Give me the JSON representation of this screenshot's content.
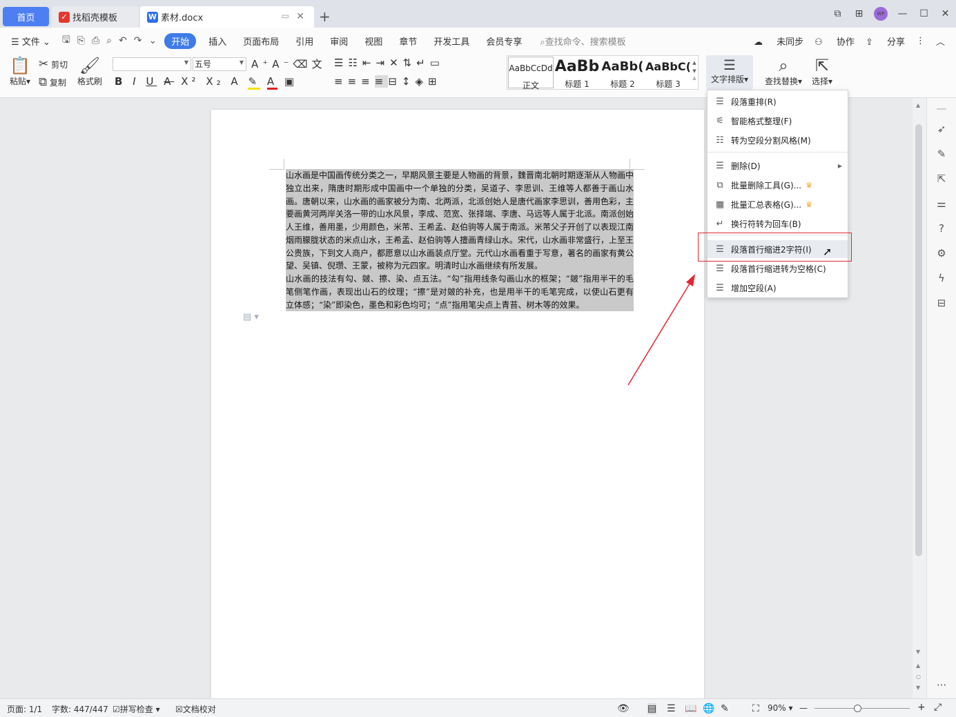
{
  "tabs": {
    "home": "首页",
    "template": "找稻壳模板",
    "document": "素材.docx"
  },
  "avatar_text": "WP",
  "menu": {
    "file": "文件",
    "items": [
      "开始",
      "插入",
      "页面布局",
      "引用",
      "审阅",
      "视图",
      "章节",
      "开发工具",
      "会员专享"
    ],
    "active": "开始",
    "search_placeholder": "查找命令、搜索模板",
    "right": [
      "未同步",
      "协作",
      "分享"
    ]
  },
  "ribbon": {
    "paste": "粘贴",
    "cut": "剪切",
    "copy": "复制",
    "format_painter": "格式刷",
    "font_name": "",
    "font_size": "五号",
    "styles": [
      {
        "preview": "AaBbCcDd",
        "label": "正文"
      },
      {
        "preview": "AaBb",
        "label": "标题 1"
      },
      {
        "preview": "AaBb(",
        "label": "标题 2"
      },
      {
        "preview": "AaBbC(",
        "label": "标题 3"
      }
    ],
    "text_layout": "文字排版",
    "find_replace": "查找替换",
    "select": "选择"
  },
  "dropdown": {
    "items": [
      {
        "label": "段落重排(R)",
        "icon": "paragraph-rearrange-icon",
        "group": 1
      },
      {
        "label": "智能格式整理(F)",
        "icon": "smart-format-icon",
        "group": 1
      },
      {
        "label": "转为空段分割风格(M)",
        "icon": "empty-paragraph-icon",
        "group": 1
      },
      {
        "label": "删除(D)",
        "icon": "delete-icon",
        "group": 2,
        "submenu": true
      },
      {
        "label": "批量删除工具(G)...",
        "icon": "batch-delete-icon",
        "group": 2,
        "premium": true
      },
      {
        "label": "批量汇总表格(G)...",
        "icon": "batch-table-icon",
        "group": 2,
        "premium": true
      },
      {
        "label": "换行符转为回车(B)",
        "icon": "linebreak-icon",
        "group": 2
      },
      {
        "label": "段落首行缩进2字符(I)",
        "icon": "indent-icon",
        "group": 3,
        "highlighted": true
      },
      {
        "label": "段落首行缩进转为空格(C)",
        "icon": "indent-space-icon",
        "group": 3
      },
      {
        "label": "增加空段(A)",
        "icon": "add-paragraph-icon",
        "group": 3
      }
    ]
  },
  "document": {
    "paragraphs": [
      "山水画是中国画传统分类之一，早期风景主要是人物画的背景，魏晋南北朝时期逐渐从人物画中独立出来，隋唐时期形成中国画中一个单独的分类，吴道子、李思训、王维等人都善于画山水画。唐朝以来，山水画的画家被分为南、北两派，北派创始人是唐代画家李思训，善用色彩，主要画黄河两岸关洛一带的山水风景，李成、范宽、张择端、李唐、马远等人属于北派。南派创始人王维，善用墨，少用颜色，米芾、王希孟、赵伯驹等人属于南派。米芾父子开创了以表现江南烟雨朦胧状态的米点山水，王希孟、赵伯驹等人擅画青绿山水。宋代，山水画非常盛行，上至王公贵族，下到文人商户，都愿意以山水画装点厅堂。元代山水画看重于写意，著名的画家有黄公望、吴镇、倪瓒、王蒙，被称为元四家。明清时山水画继续有所发展。",
      "山水画的技法有勾、皴、擦、染、点五法。“勾”指用线条勾画山水的框架；“皴”指用半干的毛笔侧笔作画，表现出山石的纹理；“擦”是对皴的补充，也是用半干的毛笔完成，以使山石更有立体感；“染”即染色，墨色和彩色均可；“点”指用笔尖点上青苔、树木等的效果。"
    ]
  },
  "status": {
    "page": "页面: 1/1",
    "words": "字数: 447/447",
    "spell_check": "拼写检查",
    "doc_check": "文档校对",
    "zoom": "90%"
  },
  "colors": {
    "accent": "#3f7be8",
    "highlight_box": "#e3262f",
    "selection": "#c9c9c9"
  }
}
